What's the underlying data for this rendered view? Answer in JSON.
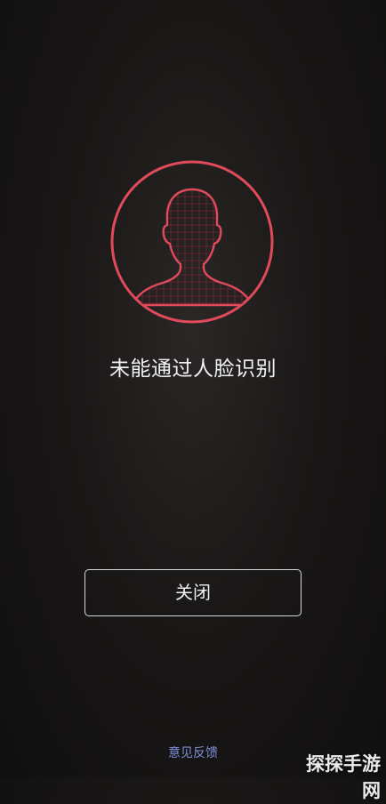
{
  "face_scan": {
    "icon": "face-recognition-failed-icon",
    "accent_color": "#e04a5a"
  },
  "message": "未能通过人脸识别",
  "close_button": {
    "label": "关闭"
  },
  "feedback_link": {
    "label": "意见反馈",
    "color": "#7f8fd6"
  },
  "watermark": "探探手游网"
}
